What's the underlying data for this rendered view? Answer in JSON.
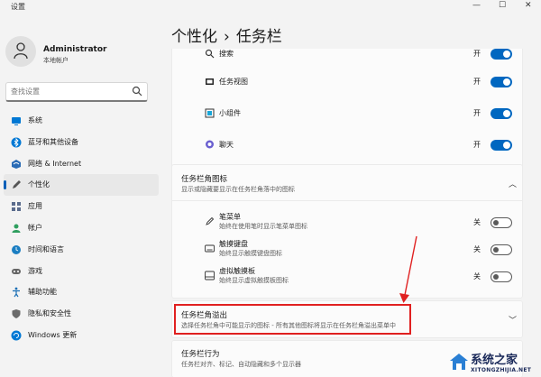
{
  "window": {
    "title": "设置",
    "controls": [
      "—",
      "☐",
      "✕"
    ]
  },
  "user": {
    "name": "Administrator",
    "account_type": "本地帐户"
  },
  "search": {
    "placeholder": "查找设置",
    "value": ""
  },
  "sidebar": {
    "items": [
      {
        "label": "系统",
        "icon": "monitor-icon",
        "active": false
      },
      {
        "label": "蓝牙和其他设备",
        "icon": "bluetooth-icon",
        "active": false
      },
      {
        "label": "网络 & Internet",
        "icon": "network-icon",
        "active": false
      },
      {
        "label": "个性化",
        "icon": "pen-icon",
        "active": true
      },
      {
        "label": "应用",
        "icon": "apps-icon",
        "active": false
      },
      {
        "label": "帐户",
        "icon": "person-icon",
        "active": false
      },
      {
        "label": "时间和语言",
        "icon": "globe-clock-icon",
        "active": false
      },
      {
        "label": "游戏",
        "icon": "gamepad-icon",
        "active": false
      },
      {
        "label": "辅助功能",
        "icon": "accessibility-icon",
        "active": false
      },
      {
        "label": "隐私和安全性",
        "icon": "shield-icon",
        "active": false
      },
      {
        "label": "Windows 更新",
        "icon": "update-icon",
        "active": false
      }
    ]
  },
  "breadcrumb": {
    "parent": "个性化",
    "separator": "›",
    "current": "任务栏"
  },
  "taskbar_items": [
    {
      "label": "搜索",
      "icon": "search-icon",
      "state": "开",
      "on": true
    },
    {
      "label": "任务视图",
      "icon": "task-view-icon",
      "state": "开",
      "on": true
    },
    {
      "label": "小组件",
      "icon": "widgets-icon",
      "state": "开",
      "on": true
    },
    {
      "label": "聊天",
      "icon": "chat-icon",
      "state": "开",
      "on": true
    }
  ],
  "corner_icons": {
    "title": "任务栏角图标",
    "subtitle": "显示或隐藏要显示在任务栏角落中的图标",
    "items": [
      {
        "label": "笔菜单",
        "sub": "始终在使用笔时显示笔菜单图标",
        "icon": "pen-menu-icon",
        "state": "关",
        "on": false
      },
      {
        "label": "触摸键盘",
        "sub": "始终显示触摸键盘图标",
        "icon": "keyboard-icon",
        "state": "关",
        "on": false
      },
      {
        "label": "虚拟触摸板",
        "sub": "始终显示虚拟触摸板图标",
        "icon": "touchpad-icon",
        "state": "关",
        "on": false
      }
    ]
  },
  "corner_overflow": {
    "title": "任务栏角溢出",
    "subtitle": "选择任务栏角中可能显示的图标 - 所有其他图标将显示在任务栏角溢出菜单中"
  },
  "behaviors": {
    "title": "任务栏行为",
    "subtitle": "任务栏对齐、标记、自动隐藏和多个显示器"
  },
  "watermark": {
    "brand": "系统之家",
    "url": "XITONGZHIJIA.NET"
  },
  "colors": {
    "accent": "#0067c0",
    "highlight": "#e02020"
  }
}
